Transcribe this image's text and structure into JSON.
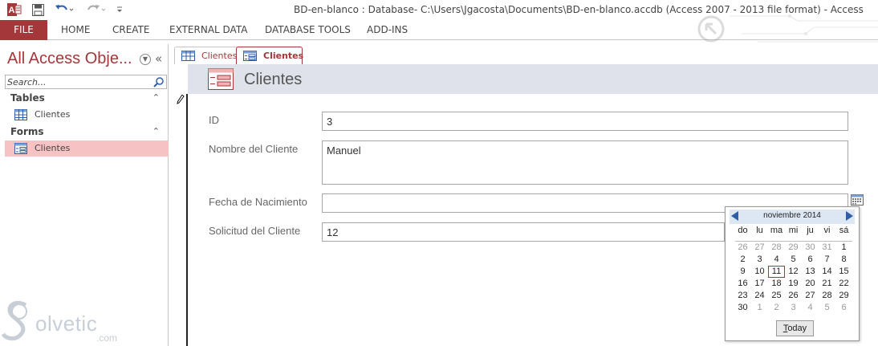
{
  "window": {
    "title": "BD-en-blanco : Database- C:\\Users\\Jgacosta\\Documents\\BD-en-blanco.accdb (Access 2007 - 2013 file format) - Access"
  },
  "qat": {
    "app_icon": "access-app-icon",
    "save_icon": "save-icon",
    "undo_icon": "undo-icon",
    "redo_icon": "redo-icon",
    "customize_icon": "customize-qat-icon"
  },
  "ribbon": {
    "tabs": [
      "FILE",
      "HOME",
      "CREATE",
      "EXTERNAL DATA",
      "DATABASE TOOLS",
      "ADD-INS"
    ],
    "file_color": "#a4373a"
  },
  "navpane": {
    "title": "All Access Obje...",
    "search_placeholder": "Search...",
    "groups": [
      {
        "label": "Tables",
        "items": [
          {
            "label": "Clientes",
            "icon": "table-icon"
          }
        ]
      },
      {
        "label": "Forms",
        "items": [
          {
            "label": "Clientes",
            "icon": "form-icon",
            "selected": true
          }
        ]
      }
    ],
    "selected_bg": "#f7c2c4"
  },
  "doc_tabs": [
    {
      "label": "Clientes",
      "icon": "table-icon",
      "active": false
    },
    {
      "label": "Clientes",
      "icon": "form-icon",
      "active": true
    }
  ],
  "form": {
    "title": "Clientes",
    "fields": [
      {
        "label": "ID",
        "value": "3"
      },
      {
        "label": "Nombre del Cliente",
        "value": "Manuel"
      },
      {
        "label": "Fecha de Nacimiento",
        "value": ""
      },
      {
        "label": "Solicitud del Cliente",
        "value": "12"
      }
    ]
  },
  "datepicker": {
    "month_label": "noviembre 2014",
    "weekdays": [
      "do",
      "lu",
      "ma",
      "mi",
      "ju",
      "vi",
      "sá"
    ],
    "weeks": [
      [
        {
          "d": "26",
          "o": 1
        },
        {
          "d": "27",
          "o": 1
        },
        {
          "d": "28",
          "o": 1
        },
        {
          "d": "29",
          "o": 1
        },
        {
          "d": "30",
          "o": 1
        },
        {
          "d": "31",
          "o": 1
        },
        {
          "d": "1"
        }
      ],
      [
        {
          "d": "2"
        },
        {
          "d": "3"
        },
        {
          "d": "4"
        },
        {
          "d": "5"
        },
        {
          "d": "6"
        },
        {
          "d": "7"
        },
        {
          "d": "8"
        }
      ],
      [
        {
          "d": "9"
        },
        {
          "d": "10"
        },
        {
          "d": "11",
          "t": 1
        },
        {
          "d": "12"
        },
        {
          "d": "13"
        },
        {
          "d": "14"
        },
        {
          "d": "15"
        }
      ],
      [
        {
          "d": "16"
        },
        {
          "d": "17"
        },
        {
          "d": "18"
        },
        {
          "d": "19"
        },
        {
          "d": "20"
        },
        {
          "d": "21"
        },
        {
          "d": "22"
        }
      ],
      [
        {
          "d": "23"
        },
        {
          "d": "24"
        },
        {
          "d": "25"
        },
        {
          "d": "26"
        },
        {
          "d": "27"
        },
        {
          "d": "28"
        },
        {
          "d": "29"
        }
      ],
      [
        {
          "d": "30"
        },
        {
          "d": "1",
          "o": 1
        },
        {
          "d": "2",
          "o": 1
        },
        {
          "d": "3",
          "o": 1
        },
        {
          "d": "4",
          "o": 1
        },
        {
          "d": "5",
          "o": 1
        },
        {
          "d": "6",
          "o": 1
        }
      ]
    ],
    "today_prefix": "T",
    "today_rest": "oday"
  },
  "watermark": {
    "text": "olvetic",
    "suffix": ".com"
  }
}
